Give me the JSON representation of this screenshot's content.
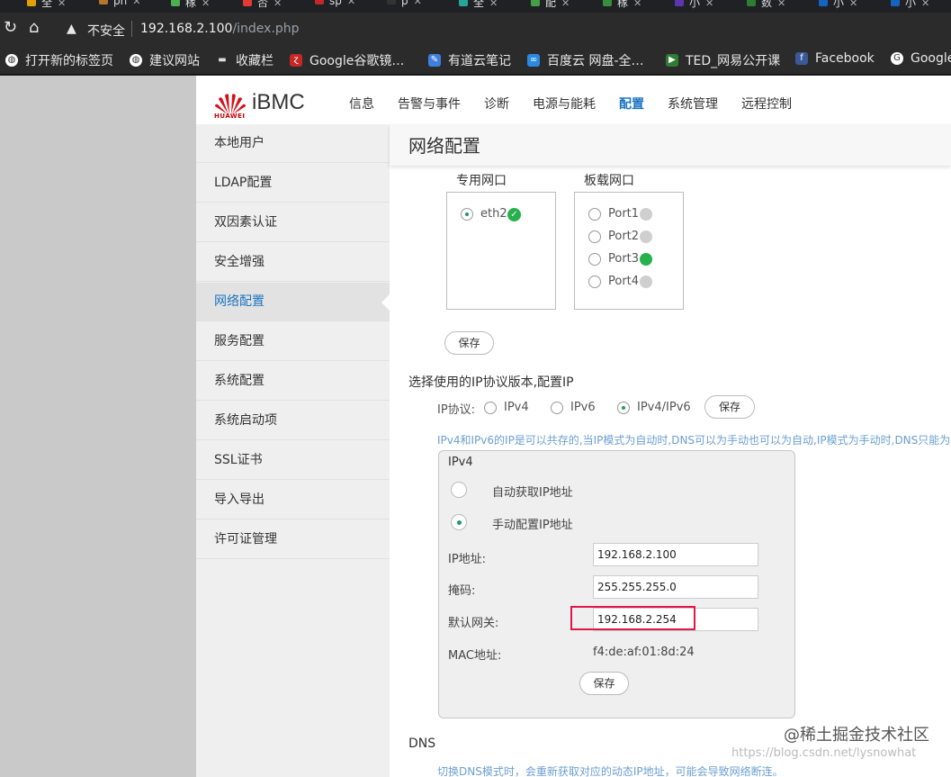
{
  "browser": {
    "tabs": [
      {
        "label": "全",
        "color": "#e0a000"
      },
      {
        "label": "ph",
        "color": "#b6762b"
      },
      {
        "label": "稼",
        "color": "#4caf50"
      },
      {
        "label": "否",
        "color": "#e53935"
      },
      {
        "label": "sp",
        "color": "#c62828"
      },
      {
        "label": "p",
        "color": "#333333"
      },
      {
        "label": "全",
        "color": "#26a69a"
      },
      {
        "label": "配",
        "color": "#43a047"
      },
      {
        "label": "稼",
        "color": "#388e3c"
      },
      {
        "label": "小",
        "color": "#5e35b1"
      },
      {
        "label": "数",
        "color": "#2e7d32"
      },
      {
        "label": "小",
        "color": "#1565c0"
      },
      {
        "label": "小",
        "color": "#1565c0"
      }
    ],
    "insecure_label": "不安全",
    "url_host": "192.168.2.100",
    "url_path": "/index.php",
    "bookmarks": [
      {
        "label": "打开新的标签页",
        "icon": "globe-icon",
        "color": "#ffffff"
      },
      {
        "label": "建议网站",
        "icon": "globe-icon",
        "color": "#ffffff"
      },
      {
        "label": "收藏栏",
        "icon": "folder-icon",
        "color": "#dddddd"
      },
      {
        "label": "Google谷歌镜…",
        "icon": "google-mirror-icon",
        "color": "#c62828"
      },
      {
        "label": "有道云笔记",
        "icon": "youdao-icon",
        "color": "#3f7fe0"
      },
      {
        "label": "百度云 网盘-全…",
        "icon": "baidu-cloud-icon",
        "color": "#2b8ae0"
      },
      {
        "label": "TED_网易公开课",
        "icon": "ted-icon",
        "color": "#2e7d32"
      },
      {
        "label": "Facebook",
        "icon": "facebook-icon",
        "color": "#3b5998"
      },
      {
        "label": "Google",
        "icon": "google-icon",
        "color": "#ffffff"
      }
    ]
  },
  "app": {
    "brand": "iBMC",
    "brand_sub": "HUAWEI",
    "menu": [
      "信息",
      "告警与事件",
      "诊断",
      "电源与能耗",
      "配置",
      "系统管理",
      "远程控制"
    ],
    "active_menu": "配置"
  },
  "sidebar": {
    "items": [
      "本地用户",
      "LDAP配置",
      "双因素认证",
      "安全增强",
      "网络配置",
      "服务配置",
      "系统配置",
      "系统启动项",
      "SSL证书",
      "导入导出",
      "许可证管理"
    ],
    "active": "网络配置"
  },
  "main": {
    "title": "网络配置",
    "dedicated_port_label": "专用网口",
    "onboard_port_label": "板载网口",
    "dedicated_ports": [
      {
        "name": "eth2",
        "selected": true,
        "status": "ok"
      }
    ],
    "onboard_ports": [
      {
        "name": "Port1",
        "selected": false,
        "status": "inactive"
      },
      {
        "name": "Port2",
        "selected": false,
        "status": "inactive"
      },
      {
        "name": "Port3",
        "selected": false,
        "status": "active"
      },
      {
        "name": "Port4",
        "selected": false,
        "status": "inactive"
      }
    ],
    "save_label": "保存",
    "ip_section_title": "选择使用的IP协议版本,配置IP",
    "ip_protocol_label": "IP协议:",
    "ip_protocol_options": [
      "IPv4",
      "IPv6",
      "IPv4/IPv6"
    ],
    "ip_protocol_selected": "IPv4/IPv6",
    "hint": "IPv4和IPv6的IP是可以共存的,当IP模式为自动时,DNS可以为手动也可以为自动,IP模式为手动时,DNS只能为手动",
    "ipv4": {
      "title": "IPv4",
      "auto_label": "自动获取IP地址",
      "manual_label": "手动配置IP地址",
      "mode": "manual",
      "ip_label": "IP地址:",
      "ip_value": "192.168.2.100",
      "mask_label": "掩码:",
      "mask_value": "255.255.255.0",
      "gateway_label": "默认网关:",
      "gateway_value": "192.168.2.254",
      "mac_label": "MAC地址:",
      "mac_value": "f4:de:af:01:8d:24"
    },
    "dns_title": "DNS",
    "dns_hint": "切换DNS模式时，会重新获取对应的动态IP地址，可能会导致网络断连。"
  },
  "watermark": {
    "text": "@稀土掘金技术社区",
    "url": "https://blog.csdn.net/lysnowhat"
  },
  "colors": {
    "accent": "#1a74c4",
    "ok_green": "#26b14c",
    "highlight_red": "#e0174a"
  }
}
